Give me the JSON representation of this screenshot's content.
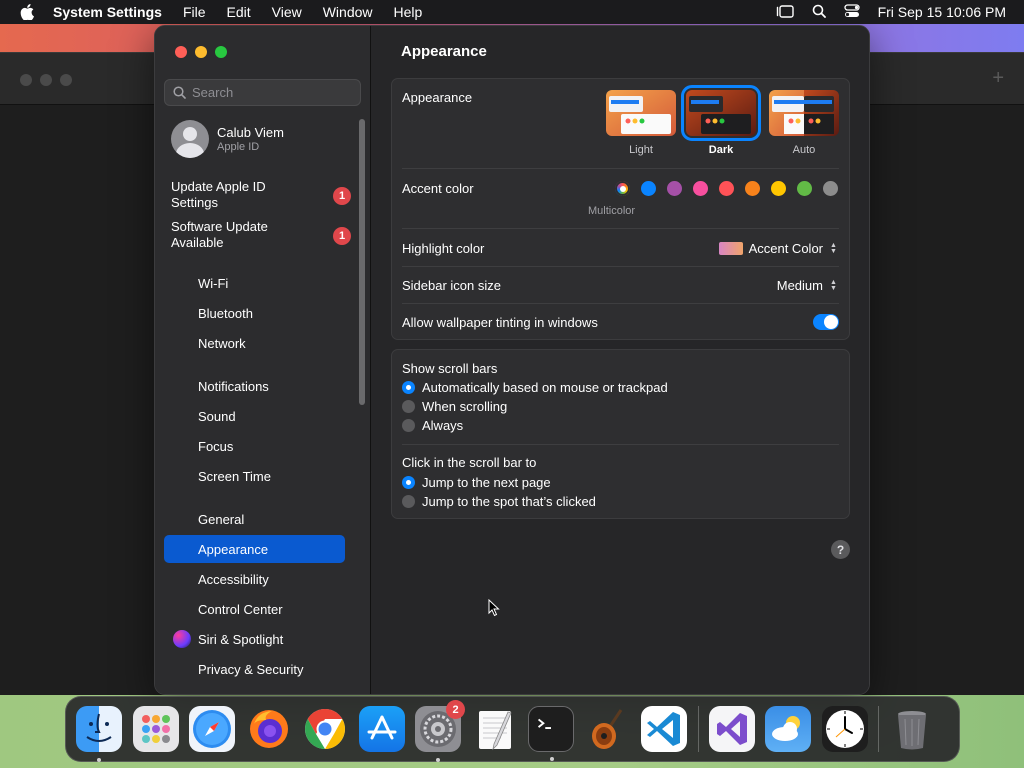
{
  "menubar": {
    "app_name": "System Settings",
    "menus": [
      "File",
      "Edit",
      "View",
      "Window",
      "Help"
    ],
    "clock": "Fri Sep 15  10:06 PM"
  },
  "sidebar": {
    "search_placeholder": "Search",
    "profile": {
      "name": "Calub Viem",
      "subtitle": "Apple ID"
    },
    "notices": [
      {
        "label": "Update Apple ID Settings",
        "badge": "1"
      },
      {
        "label": "Software Update Available",
        "badge": "1"
      }
    ],
    "items": [
      {
        "label": "Wi-Fi"
      },
      {
        "label": "Bluetooth"
      },
      {
        "label": "Network"
      },
      {
        "label": "Notifications"
      },
      {
        "label": "Sound"
      },
      {
        "label": "Focus"
      },
      {
        "label": "Screen Time"
      },
      {
        "label": "General"
      },
      {
        "label": "Appearance",
        "selected": true
      },
      {
        "label": "Accessibility"
      },
      {
        "label": "Control Center"
      },
      {
        "label": "Siri & Spotlight"
      },
      {
        "label": "Privacy & Security"
      }
    ]
  },
  "content": {
    "title": "Appearance",
    "appearance": {
      "label": "Appearance",
      "options": [
        {
          "label": "Light",
          "selected": false
        },
        {
          "label": "Dark",
          "selected": true
        },
        {
          "label": "Auto",
          "selected": false
        }
      ]
    },
    "accent": {
      "label": "Accent color",
      "selected_label": "Multicolor",
      "colors": [
        "multicolor",
        "#0a84ff",
        "#a550a7",
        "#f74f9e",
        "#ff5257",
        "#f7821b",
        "#ffc600",
        "#62ba46",
        "#8c8c8c"
      ]
    },
    "highlight": {
      "label": "Highlight color",
      "value": "Accent Color"
    },
    "sidebar_icon_size": {
      "label": "Sidebar icon size",
      "value": "Medium"
    },
    "wallpaper_tinting": {
      "label": "Allow wallpaper tinting in windows",
      "enabled": true
    },
    "scroll_bars": {
      "label": "Show scroll bars",
      "options": [
        {
          "label": "Automatically based on mouse or trackpad",
          "selected": true
        },
        {
          "label": "When scrolling",
          "selected": false
        },
        {
          "label": "Always",
          "selected": false
        }
      ]
    },
    "click_scroll": {
      "label": "Click in the scroll bar to",
      "options": [
        {
          "label": "Jump to the next page",
          "selected": true
        },
        {
          "label": "Jump to the spot that’s clicked",
          "selected": false
        }
      ]
    },
    "help_glyph": "?"
  },
  "dock": {
    "system_settings_badge": "2",
    "apps": [
      "finder-icon",
      "launchpad-icon",
      "safari-icon",
      "firefox-icon",
      "chrome-icon",
      "app-store-icon",
      "system-settings-icon",
      "textedit-icon",
      "terminal-icon",
      "garageband-icon",
      "vscode-icon",
      "visual-studio-icon",
      "weather-icon",
      "clock-icon",
      "trash-icon"
    ]
  },
  "colors": {
    "accent": "#0a84ff",
    "selection": "#0a5ad0",
    "badge": "#e0474b"
  }
}
